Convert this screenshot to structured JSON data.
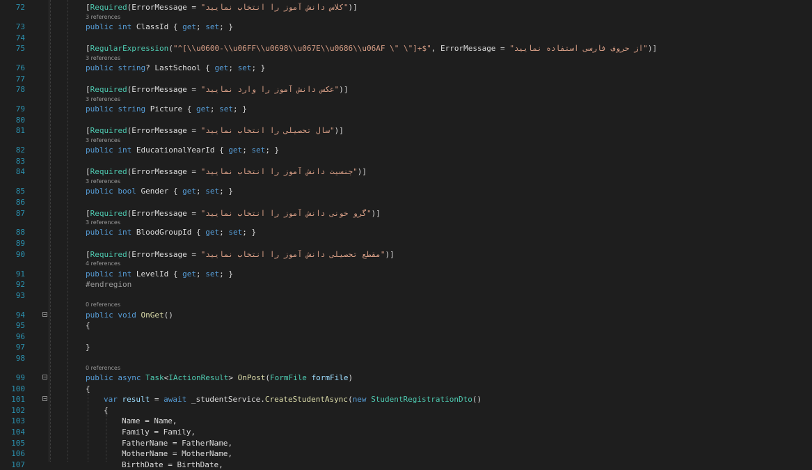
{
  "editor": {
    "colors": {
      "background": "#1e1e1e",
      "line_number": "#2b91af",
      "keyword": "#569cd6",
      "type": "#4ec9b0",
      "string": "#d69d85",
      "method": "#dcdcaa",
      "param": "#9cdcfe",
      "text": "#dcdcdc",
      "codelens": "#9a9a9a"
    },
    "lines": [
      {
        "n": "72",
        "lens": "",
        "fold": "",
        "indent": 0,
        "tokens": [
          {
            "c": "pl",
            "t": "["
          },
          {
            "c": "ty",
            "t": "Required"
          },
          {
            "c": "pl",
            "t": "(ErrorMessage = "
          },
          {
            "c": "st",
            "t": "\"کلاس دانش آموز را انتخاب نمایید\""
          },
          {
            "c": "pl",
            "t": ")]"
          }
        ]
      },
      {
        "n": "73",
        "lens": "3 references",
        "fold": "",
        "indent": 0,
        "tokens": [
          {
            "c": "kw",
            "t": "public int"
          },
          {
            "c": "pl",
            "t": " ClassId { "
          },
          {
            "c": "kw",
            "t": "get"
          },
          {
            "c": "pl",
            "t": "; "
          },
          {
            "c": "kw",
            "t": "set"
          },
          {
            "c": "pl",
            "t": "; }"
          }
        ]
      },
      {
        "n": "74",
        "lens": "",
        "fold": "",
        "indent": 0,
        "tokens": []
      },
      {
        "n": "75",
        "lens": "",
        "fold": "",
        "indent": 0,
        "tokens": [
          {
            "c": "pl",
            "t": "["
          },
          {
            "c": "ty",
            "t": "RegularExpression"
          },
          {
            "c": "pl",
            "t": "("
          },
          {
            "c": "st",
            "t": "\"^[\\\\u0600-\\\\u06FF\\\\u0698\\\\u067E\\\\u0686\\\\u06AF \\\" \\\"]+$\""
          },
          {
            "c": "pl",
            "t": ", ErrorMessage = "
          },
          {
            "c": "st",
            "t": "\"از حروف فارسی استفاده نمایید\""
          },
          {
            "c": "pl",
            "t": ")]"
          }
        ]
      },
      {
        "n": "76",
        "lens": "3 references",
        "fold": "",
        "indent": 0,
        "tokens": [
          {
            "c": "kw",
            "t": "public string"
          },
          {
            "c": "pl",
            "t": "? LastSchool { "
          },
          {
            "c": "kw",
            "t": "get"
          },
          {
            "c": "pl",
            "t": "; "
          },
          {
            "c": "kw",
            "t": "set"
          },
          {
            "c": "pl",
            "t": "; }"
          }
        ]
      },
      {
        "n": "77",
        "lens": "",
        "fold": "",
        "indent": 0,
        "tokens": []
      },
      {
        "n": "78",
        "lens": "",
        "fold": "",
        "indent": 0,
        "tokens": [
          {
            "c": "pl",
            "t": "["
          },
          {
            "c": "ty",
            "t": "Required"
          },
          {
            "c": "pl",
            "t": "(ErrorMessage = "
          },
          {
            "c": "st",
            "t": "\"عکس دانش آموز را وارد نمایید\""
          },
          {
            "c": "pl",
            "t": ")]"
          }
        ]
      },
      {
        "n": "79",
        "lens": "3 references",
        "fold": "",
        "indent": 0,
        "tokens": [
          {
            "c": "kw",
            "t": "public string"
          },
          {
            "c": "pl",
            "t": " Picture { "
          },
          {
            "c": "kw",
            "t": "get"
          },
          {
            "c": "pl",
            "t": "; "
          },
          {
            "c": "kw",
            "t": "set"
          },
          {
            "c": "pl",
            "t": "; }"
          }
        ]
      },
      {
        "n": "80",
        "lens": "",
        "fold": "",
        "indent": 0,
        "tokens": []
      },
      {
        "n": "81",
        "lens": "",
        "fold": "",
        "indent": 0,
        "tokens": [
          {
            "c": "pl",
            "t": "["
          },
          {
            "c": "ty",
            "t": "Required"
          },
          {
            "c": "pl",
            "t": "(ErrorMessage = "
          },
          {
            "c": "st",
            "t": "\"سال تحصیلی را انتخاب نمایید\""
          },
          {
            "c": "pl",
            "t": ")]"
          }
        ]
      },
      {
        "n": "82",
        "lens": "3 references",
        "fold": "",
        "indent": 0,
        "tokens": [
          {
            "c": "kw",
            "t": "public int"
          },
          {
            "c": "pl",
            "t": " EducationalYearId { "
          },
          {
            "c": "kw",
            "t": "get"
          },
          {
            "c": "pl",
            "t": "; "
          },
          {
            "c": "kw",
            "t": "set"
          },
          {
            "c": "pl",
            "t": "; }"
          }
        ]
      },
      {
        "n": "83",
        "lens": "",
        "fold": "",
        "indent": 0,
        "tokens": []
      },
      {
        "n": "84",
        "lens": "",
        "fold": "",
        "indent": 0,
        "tokens": [
          {
            "c": "pl",
            "t": "["
          },
          {
            "c": "ty",
            "t": "Required"
          },
          {
            "c": "pl",
            "t": "(ErrorMessage = "
          },
          {
            "c": "st",
            "t": "\"جنسیت دانش آموز را انتخاب نمایید\""
          },
          {
            "c": "pl",
            "t": ")]"
          }
        ]
      },
      {
        "n": "85",
        "lens": "3 references",
        "fold": "",
        "indent": 0,
        "tokens": [
          {
            "c": "kw",
            "t": "public bool"
          },
          {
            "c": "pl",
            "t": " Gender { "
          },
          {
            "c": "kw",
            "t": "get"
          },
          {
            "c": "pl",
            "t": "; "
          },
          {
            "c": "kw",
            "t": "set"
          },
          {
            "c": "pl",
            "t": "; }"
          }
        ]
      },
      {
        "n": "86",
        "lens": "",
        "fold": "",
        "indent": 0,
        "tokens": []
      },
      {
        "n": "87",
        "lens": "",
        "fold": "",
        "indent": 0,
        "tokens": [
          {
            "c": "pl",
            "t": "["
          },
          {
            "c": "ty",
            "t": "Required"
          },
          {
            "c": "pl",
            "t": "(ErrorMessage = "
          },
          {
            "c": "st",
            "t": "\"گرو خونی دانش آموز را انتخاب نمایید\""
          },
          {
            "c": "pl",
            "t": ")]"
          }
        ]
      },
      {
        "n": "88",
        "lens": "3 references",
        "fold": "",
        "indent": 0,
        "tokens": [
          {
            "c": "kw",
            "t": "public int"
          },
          {
            "c": "pl",
            "t": " BloodGroupId { "
          },
          {
            "c": "kw",
            "t": "get"
          },
          {
            "c": "pl",
            "t": "; "
          },
          {
            "c": "kw",
            "t": "set"
          },
          {
            "c": "pl",
            "t": "; }"
          }
        ]
      },
      {
        "n": "89",
        "lens": "",
        "fold": "",
        "indent": 0,
        "tokens": []
      },
      {
        "n": "90",
        "lens": "",
        "fold": "",
        "indent": 0,
        "tokens": [
          {
            "c": "pl",
            "t": "["
          },
          {
            "c": "ty",
            "t": "Required"
          },
          {
            "c": "pl",
            "t": "(ErrorMessage = "
          },
          {
            "c": "st",
            "t": "\"مقطع تحصیلی دانش آموز را انتخاب نمایید\""
          },
          {
            "c": "pl",
            "t": ")]"
          }
        ]
      },
      {
        "n": "91",
        "lens": "4 references",
        "fold": "",
        "indent": 0,
        "tokens": [
          {
            "c": "kw",
            "t": "public int"
          },
          {
            "c": "pl",
            "t": " LevelId { "
          },
          {
            "c": "kw",
            "t": "get"
          },
          {
            "c": "pl",
            "t": "; "
          },
          {
            "c": "kw",
            "t": "set"
          },
          {
            "c": "pl",
            "t": "; }"
          }
        ]
      },
      {
        "n": "92",
        "lens": "",
        "fold": "",
        "indent": 0,
        "tokens": [
          {
            "c": "dir",
            "t": "#endregion"
          }
        ]
      },
      {
        "n": "93",
        "lens": "",
        "fold": "",
        "indent": 0,
        "tokens": []
      },
      {
        "n": "94",
        "lens": "0 references",
        "fold": "−",
        "indent": 0,
        "tokens": [
          {
            "c": "kw",
            "t": "public void"
          },
          {
            "c": "pl",
            "t": " "
          },
          {
            "c": "me",
            "t": "OnGet"
          },
          {
            "c": "pl",
            "t": "()"
          }
        ]
      },
      {
        "n": "95",
        "lens": "",
        "fold": "",
        "indent": 0,
        "tokens": [
          {
            "c": "pl",
            "t": "{"
          }
        ]
      },
      {
        "n": "96",
        "lens": "",
        "fold": "",
        "indent": 0,
        "tokens": []
      },
      {
        "n": "97",
        "lens": "",
        "fold": "",
        "indent": 0,
        "tokens": [
          {
            "c": "pl",
            "t": "}"
          }
        ]
      },
      {
        "n": "98",
        "lens": "",
        "fold": "",
        "indent": 0,
        "tokens": []
      },
      {
        "n": "99",
        "lens": "0 references",
        "fold": "−",
        "indent": 0,
        "tokens": [
          {
            "c": "kw",
            "t": "public async"
          },
          {
            "c": "pl",
            "t": " "
          },
          {
            "c": "ty",
            "t": "Task"
          },
          {
            "c": "pl",
            "t": "<"
          },
          {
            "c": "ty",
            "t": "IActionResult"
          },
          {
            "c": "pl",
            "t": "> "
          },
          {
            "c": "me",
            "t": "OnPost"
          },
          {
            "c": "pl",
            "t": "("
          },
          {
            "c": "ty",
            "t": "FormFile"
          },
          {
            "c": "pl",
            "t": " "
          },
          {
            "c": "pr",
            "t": "formFile"
          },
          {
            "c": "pl",
            "t": ")"
          }
        ]
      },
      {
        "n": "100",
        "lens": "",
        "fold": "",
        "indent": 0,
        "tokens": [
          {
            "c": "pl",
            "t": "{"
          }
        ]
      },
      {
        "n": "101",
        "lens": "",
        "fold": "−",
        "indent": 1,
        "tokens": [
          {
            "c": "kw",
            "t": "var"
          },
          {
            "c": "pl",
            "t": " "
          },
          {
            "c": "pr",
            "t": "result"
          },
          {
            "c": "pl",
            "t": " = "
          },
          {
            "c": "kw",
            "t": "await"
          },
          {
            "c": "pl",
            "t": " _studentService."
          },
          {
            "c": "me",
            "t": "CreateStudentAsync"
          },
          {
            "c": "pl",
            "t": "("
          },
          {
            "c": "kw",
            "t": "new"
          },
          {
            "c": "pl",
            "t": " "
          },
          {
            "c": "ty",
            "t": "StudentRegistrationDto"
          },
          {
            "c": "pl",
            "t": "()"
          }
        ]
      },
      {
        "n": "102",
        "lens": "",
        "fold": "",
        "indent": 1,
        "tokens": [
          {
            "c": "pl",
            "t": "{"
          }
        ]
      },
      {
        "n": "103",
        "lens": "",
        "fold": "",
        "indent": 2,
        "tokens": [
          {
            "c": "pl",
            "t": "Name = Name,"
          }
        ]
      },
      {
        "n": "104",
        "lens": "",
        "fold": "",
        "indent": 2,
        "tokens": [
          {
            "c": "pl",
            "t": "Family = Family,"
          }
        ]
      },
      {
        "n": "105",
        "lens": "",
        "fold": "",
        "indent": 2,
        "tokens": [
          {
            "c": "pl",
            "t": "FatherName = FatherName,"
          }
        ]
      },
      {
        "n": "106",
        "lens": "",
        "fold": "",
        "indent": 2,
        "tokens": [
          {
            "c": "pl",
            "t": "MotherName = MotherName,"
          }
        ]
      },
      {
        "n": "107",
        "lens": "",
        "fold": "",
        "indent": 2,
        "tokens": [
          {
            "c": "pl",
            "t": "BirthDate = BirthDate,"
          }
        ]
      }
    ]
  }
}
